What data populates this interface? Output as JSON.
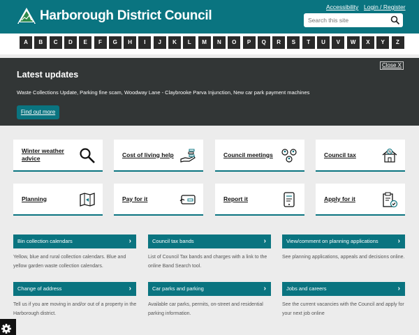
{
  "header": {
    "title": "Harborough District Council",
    "links": [
      "Accessibility",
      "Login / Register"
    ],
    "search_placeholder": "Search this site"
  },
  "az": [
    "A",
    "B",
    "C",
    "D",
    "E",
    "F",
    "G",
    "H",
    "I",
    "J",
    "K",
    "L",
    "M",
    "N",
    "O",
    "P",
    "Q",
    "R",
    "S",
    "T",
    "U",
    "V",
    "W",
    "X",
    "Y",
    "Z"
  ],
  "updates": {
    "close_label": "Close X",
    "title": "Latest updates",
    "text": "Waste Collections Update, Parking fine scam, Woodway Lane - Claybrooke Parva Injunction, New car park payment machines",
    "button": "Find out more"
  },
  "tiles": [
    {
      "label": "Winter weather advice",
      "icon": "magnifier-icon"
    },
    {
      "label": "Cost of living help",
      "icon": "hand-coins-icon"
    },
    {
      "label": "Council meetings",
      "icon": "people-meeting-icon"
    },
    {
      "label": "Council tax",
      "icon": "house-percent-icon"
    },
    {
      "label": "Planning",
      "icon": "map-icon"
    },
    {
      "label": "Pay for it",
      "icon": "payment-card-icon"
    },
    {
      "label": "Report it",
      "icon": "phone-report-icon"
    },
    {
      "label": "Apply for it",
      "icon": "clipboard-check-icon"
    }
  ],
  "services": [
    {
      "title": "Bin collection calendars",
      "desc": "Yellow, blue and rural collection calendars. Blue and yellow garden waste collection calendars."
    },
    {
      "title": "Council tax bands",
      "desc": "List of Council Tax bands and charges with a link to the online Band Search tool."
    },
    {
      "title": "View/comment on planning applications",
      "desc": "See planning applications, appeals and decisions online."
    },
    {
      "title": "Change of address",
      "desc": "Tell us if you are moving in and/or out of a property in the Harborough district."
    },
    {
      "title": "Car parks and parking",
      "desc": "Available car parks, permits, on-street and residential parking information."
    },
    {
      "title": "Jobs and careers",
      "desc": "See the current vacancies with the Council and apply for your next job online"
    }
  ],
  "colors": {
    "brand": "#0a7480",
    "dark_banner": "#323636",
    "az_button": "#2a2a2a"
  }
}
